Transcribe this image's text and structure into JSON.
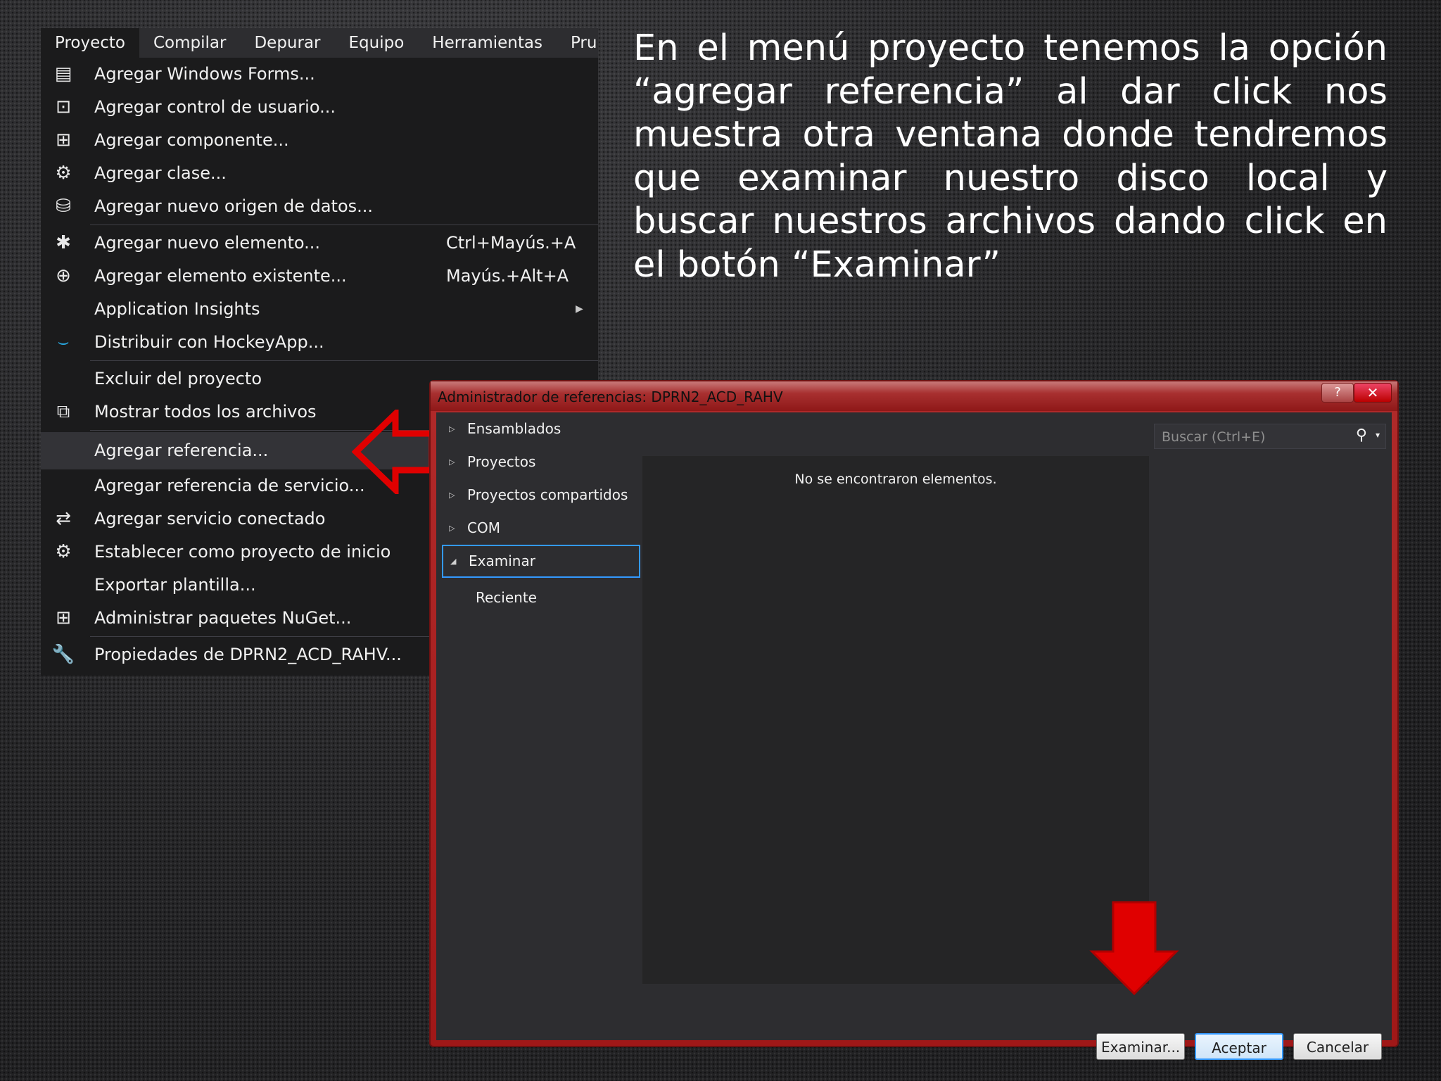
{
  "caption": "En el menú proyecto tenemos la opción “agregar referencia” al dar click nos muestra otra ventana donde tendremos que examinar nuestro disco local y buscar nuestros archivos dando click en el botón “Examinar”",
  "menubar": [
    "Proyecto",
    "Compilar",
    "Depurar",
    "Equipo",
    "Herramientas",
    "Pru"
  ],
  "menu": {
    "items": [
      {
        "label": "Agregar Windows Forms...",
        "icon": "windows-form-icon"
      },
      {
        "label": "Agregar control de usuario...",
        "icon": "user-control-icon"
      },
      {
        "label": "Agregar componente...",
        "icon": "component-icon"
      },
      {
        "label": "Agregar clase...",
        "icon": "class-icon"
      },
      {
        "label": "Agregar nuevo origen de datos...",
        "icon": "data-source-icon"
      },
      {
        "label": "Agregar nuevo elemento...",
        "shortcut": "Ctrl+Mayús.+A",
        "icon": "new-item-icon"
      },
      {
        "label": "Agregar elemento existente...",
        "shortcut": "Mayús.+Alt+A",
        "icon": "existing-item-icon"
      },
      {
        "label": "Application Insights",
        "icon": ""
      },
      {
        "label": "Distribuir con HockeyApp...",
        "icon": "hockeyapp-icon"
      },
      {
        "label": "Excluir del proyecto",
        "icon": ""
      },
      {
        "label": "Mostrar todos los archivos",
        "icon": "show-all-files-icon"
      },
      {
        "label": "Agregar referencia...",
        "icon": ""
      },
      {
        "label": "Agregar referencia de servicio...",
        "icon": ""
      },
      {
        "label": "Agregar servicio conectado",
        "icon": "connected-service-icon"
      },
      {
        "label": "Establecer como proyecto de inicio",
        "icon": "gear-icon"
      },
      {
        "label": "Exportar plantilla...",
        "icon": ""
      },
      {
        "label": "Administrar paquetes NuGet...",
        "icon": "nuget-icon"
      },
      {
        "label": "Propiedades de DPRN2_ACD_RAHV...",
        "icon": "wrench-icon"
      }
    ]
  },
  "dialog": {
    "title": "Administrador de referencias: DPRN2_ACD_RAHV",
    "help": "?",
    "close": "✕",
    "tree": [
      "Ensamblados",
      "Proyectos",
      "Proyectos compartidos",
      "COM",
      "Examinar",
      "Reciente"
    ],
    "empty_message": "No se encontraron elementos.",
    "search_placeholder": "Buscar (Ctrl+E)",
    "buttons": {
      "browse": "Examinar...",
      "ok": "Aceptar",
      "cancel": "Cancelar"
    }
  },
  "colors": {
    "arrow": "#e00000",
    "selection_border": "#3399ff",
    "dialog_frame": "#a01818"
  }
}
